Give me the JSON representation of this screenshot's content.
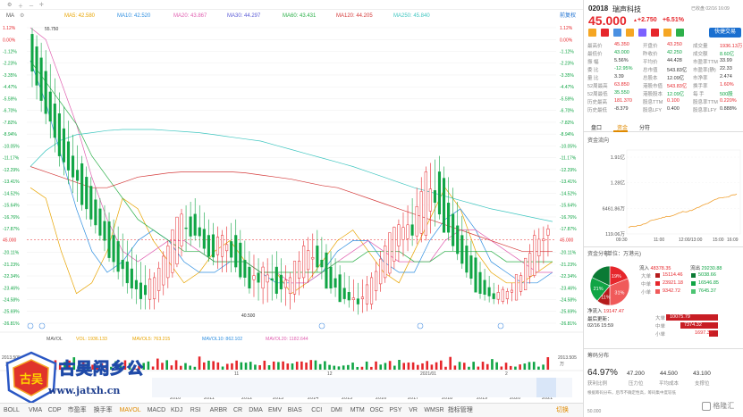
{
  "toolbar_top": {
    "ma_label": "MA",
    "ma_items": [
      {
        "label": "MA5: 42.580",
        "color": "#e8a400"
      },
      {
        "label": "MA10: 42.520",
        "color": "#2f8fe0"
      },
      {
        "label": "MA20: 43.867",
        "color": "#e060b0"
      },
      {
        "label": "MA30: 44.297",
        "color": "#5b5bd6"
      },
      {
        "label": "MA60: 43.431",
        "color": "#2db04a"
      },
      {
        "label": "MA120: 44.205",
        "color": "#d43a3a"
      },
      {
        "label": "MA250: 45.840",
        "color": "#3fc6c0"
      }
    ],
    "right_label": "前复权"
  },
  "price_axis": {
    "left_labels": [
      "1.12%",
      "0.00%",
      "-1.12%",
      "-2.23%",
      "-3.35%",
      "-4.47%",
      "-5.59%",
      "-6.70%",
      "-7.82%",
      "-8.94%",
      "-10.05%",
      "-11.17%",
      "-12.29%",
      "-13.41%",
      "-14.52%",
      "-15.64%",
      "-16.76%",
      "-17.87%",
      "-20.11%",
      "-21.23%",
      "-22.34%",
      "-23.46%",
      "-24.58%",
      "-25.69%",
      "-26.81%"
    ],
    "right_labels": [
      "1.12%",
      "0.00%",
      "-1.12%",
      "-2.23%",
      "-3.35%",
      "-4.47%",
      "-5.59%",
      "-6.70%",
      "-7.82%",
      "-8.94%",
      "-10.05%",
      "-11.17%",
      "-12.29%",
      "-13.41%",
      "-14.52%",
      "-15.64%",
      "-16.76%",
      "-17.87%",
      "-20.11%",
      "-21.23%",
      "-22.34%",
      "-23.46%",
      "-24.58%",
      "-25.69%",
      "-26.81%"
    ],
    "current_price": "45.000",
    "high_marker": "55.750",
    "low_marker": "40.500"
  },
  "volume": {
    "title": "MAVOL",
    "vol": "VOL: 1936.133",
    "mavol5": "MAVOL5: 763.215",
    "mavol10": "MAVOL10: 862.102",
    "mavol20": "MAVOL20: 1182.644",
    "axis_top": "2013.505",
    "axis_top_unit": "万",
    "axis_right_top": "2013.505",
    "axis_right_unit": "万"
  },
  "time_axis": [
    "2010",
    "2011",
    "2012",
    "2013",
    "2014",
    "2015",
    "2016",
    "2017",
    "2018",
    "2019",
    "2020",
    "2021"
  ],
  "time_axis_extra": {
    "mid": "2021/01",
    "a": "11",
    "b": "12",
    "c": "2"
  },
  "bottom_tabs": [
    "VMA",
    "CDP",
    "市盈率",
    "换手率",
    "MAVOL",
    "MACD",
    "KDJ",
    "RSI",
    "ARBR",
    "CR",
    "DMA",
    "EMV",
    "BIAS",
    "CCI",
    "DMI",
    "MTM",
    "OSC",
    "PSY",
    "VR",
    "WMSR",
    "指标管理"
  ],
  "bottom_right": "切换",
  "bottom_left": "BOLL",
  "watermark": {
    "title": "古吴闲乡公",
    "url": "www.jatxh.cn"
  },
  "stock": {
    "code": "02018",
    "name": "瑞声科技",
    "date": "已收盘 02/16 16:09",
    "price": "45.000",
    "change": "+2.750",
    "pct": "+6.51%",
    "trade_button": "快捷交易"
  },
  "quote_table": [
    [
      "最高价",
      "45.350",
      "开盘价",
      "43.250",
      "成交量",
      "1936.13万"
    ],
    [
      "最低价",
      "43.000",
      "昨收价",
      "42.250",
      "成交额",
      "8.60亿"
    ],
    [
      "振    幅",
      "5.56%",
      "平均价",
      "44.428",
      "市盈率TTM",
      "33.99"
    ],
    [
      "委    比",
      "-12.95%",
      "总市值",
      "543.83亿",
      "市盈率(静)",
      "22.33"
    ],
    [
      "量    比",
      "3.39",
      "总股本",
      "12.09亿",
      "市净率",
      "2.474"
    ],
    [
      "52周最高",
      "63.850",
      "港股市值",
      "543.83亿",
      "换手率",
      "1.60%"
    ],
    [
      "52周最低",
      "35.550",
      "港股股本",
      "12.09亿",
      "每    手",
      "500股"
    ],
    [
      "历史最高",
      "181.370",
      "股息TTM",
      "0.100",
      "股息率TTM",
      "0.220%"
    ],
    [
      "历史最低",
      "-8.379",
      "股息LFY",
      "0.400",
      "股息率LFY",
      "0.888%"
    ]
  ],
  "detail_tabs": [
    "盘口",
    "资金",
    "分符"
  ],
  "flow_chart": {
    "title": "资金流向",
    "y_labels": [
      "1.91亿",
      "1.28亿",
      "6461.86万",
      "119.06万"
    ],
    "x_labels": [
      "09:30",
      "11:00",
      "12:00/13:00",
      "15:00",
      "16:09"
    ]
  },
  "distribution": {
    "title": "资金分布",
    "unit": "(单位：万港元)",
    "inflow_label": "流入",
    "inflow_total": "48378.35",
    "outflow_label": "流出",
    "outflow_total": "29230.88",
    "rows": [
      {
        "label": "大单",
        "in": "15114.46",
        "out": "5038.66"
      },
      {
        "label": "中单",
        "in": "23921.18",
        "out": "16546.85"
      },
      {
        "label": "小单",
        "in": "9342.72",
        "out": "7645.37"
      }
    ],
    "pie": [
      {
        "label": "19%",
        "value": 19,
        "color": "#e6262b"
      },
      {
        "label": "31%",
        "value": 31,
        "color": "#f05a5a"
      },
      {
        "label": "11%",
        "value": 11,
        "color": "#b51b1b"
      },
      {
        "label": "21%",
        "value": 21,
        "color": "#10a545"
      },
      {
        "label": "",
        "value": 18,
        "color": "#0a7a34"
      }
    ],
    "net_label": "净流入",
    "net_value": "19147.47",
    "update_label": "最后更新：",
    "update_time": "02/16 15:59",
    "net_rows": [
      {
        "label": "大单",
        "value": "10075.79",
        "fraction": 1.0
      },
      {
        "label": "中单",
        "value": "7374.32",
        "fraction": 0.73
      },
      {
        "label": "小单",
        "value": "1697.35",
        "fraction": 0.17
      }
    ]
  },
  "chip": {
    "title": "筹码分布",
    "profit_pct": "64.97%",
    "profit_label": "获利比例",
    "pressure": "47.200",
    "pressure_label": "压力位",
    "avg": "44.500",
    "avg_label": "平均成本",
    "support": "43.100",
    "support_label": "支撑位",
    "note": "根据筹码分布，后市不确定性高，筹码集中度较低",
    "footer_value": "50.000",
    "brand": "格隆汇"
  },
  "colors": {
    "up": "#e6262b",
    "down": "#10a545",
    "accent": "#e08a00"
  },
  "chart_data": {
    "type": "candlestick",
    "title": "",
    "xlabel": "",
    "ylabel": "",
    "x_range": [
      "2009",
      "2021/02"
    ],
    "ylim_pct": [
      -26.81,
      1.12
    ],
    "grid": true,
    "ma_series": [
      {
        "name": "MA5",
        "color": "#e8a400",
        "pct": [
          -14,
          -15,
          -20,
          -24,
          -23,
          -20,
          -15,
          -16,
          -19,
          -21,
          -23,
          -22,
          -20,
          -19,
          -21,
          -22,
          -22,
          -24,
          -23,
          -21,
          -19,
          -18,
          -20,
          -22,
          -23,
          -20,
          -17,
          -14,
          -16,
          -20,
          -22,
          -23,
          -23,
          -22,
          -21
        ]
      },
      {
        "name": "MA10",
        "color": "#2f8fe0",
        "pct": [
          -2,
          -6,
          -11,
          -16,
          -20,
          -22,
          -21,
          -19,
          -18,
          -19,
          -21,
          -22,
          -22,
          -21,
          -21,
          -22,
          -23,
          -23,
          -23,
          -22,
          -20,
          -19,
          -19,
          -21,
          -22,
          -22,
          -19,
          -17,
          -16,
          -18,
          -21,
          -22,
          -23,
          -23,
          -22
        ]
      },
      {
        "name": "MA20",
        "color": "#e060b0",
        "pct": [
          4,
          0,
          -4,
          -8,
          -13,
          -17,
          -20,
          -21,
          -20,
          -19,
          -19,
          -20,
          -21,
          -21,
          -21,
          -22,
          -22,
          -23,
          -23,
          -22,
          -21,
          -20,
          -19,
          -20,
          -21,
          -21,
          -21,
          -19,
          -18,
          -18,
          -19,
          -20,
          -21,
          -22,
          -22
        ]
      },
      {
        "name": "MA60",
        "color": "#2db04a",
        "pct": [
          -2,
          -4,
          -6,
          -8,
          -11,
          -13,
          -15,
          -17,
          -18,
          -19,
          -20,
          -20,
          -21,
          -21,
          -21,
          -22,
          -22,
          -22,
          -22,
          -22,
          -21,
          -21,
          -20,
          -20,
          -20,
          -21,
          -21,
          -20,
          -20,
          -20,
          -20,
          -21,
          -21,
          -21,
          -21
        ]
      },
      {
        "name": "MA120",
        "color": "#d43a3a",
        "pct": [
          -12,
          -12.5,
          -13,
          -13.5,
          -14,
          -14,
          -13.5,
          -13,
          -12.8,
          -12.6,
          -12.5,
          -12.5,
          -12.5,
          -12.5,
          -12.6,
          -12.8,
          -13,
          -13.2,
          -13.5,
          -13.8,
          -14,
          -14.5,
          -15,
          -15.5,
          -16,
          -16.5,
          -17,
          -17.5,
          -18,
          -18.5,
          -19,
          -19.5,
          -20,
          -20,
          -20
        ]
      },
      {
        "name": "MA250",
        "color": "#3fc6c0",
        "pct": [
          -12,
          -10.5,
          -9.5,
          -9,
          -8.8,
          -8.6,
          -8.5,
          -8.5,
          -8.5,
          -8.6,
          -8.7,
          -8.8,
          -9,
          -9.2,
          -9.4,
          -9.6,
          -10,
          -10.4,
          -10.8,
          -11.2,
          -11.6,
          -12,
          -12.5,
          -13,
          -13.5,
          -14,
          -14.4,
          -14.8,
          -15.2,
          -15.6,
          -16,
          -16.3,
          -16.6,
          -16.9,
          -17.2
        ]
      }
    ],
    "candles_pct": [
      [
        0.5,
        1.1,
        -4.5,
        -3.0
      ],
      [
        -3,
        -1,
        -8,
        -7
      ],
      [
        -7,
        -5,
        -12,
        -11
      ],
      [
        -11,
        -9,
        -14.5,
        -13
      ],
      [
        -13,
        -12,
        -17,
        -16
      ],
      [
        -16,
        -15,
        -19,
        -18.5
      ],
      [
        -18.5,
        -17,
        -22,
        -21
      ],
      [
        -21,
        -19,
        -24,
        -23
      ],
      [
        -23,
        -21,
        -25.5,
        -24.5
      ],
      [
        -24.5,
        -22,
        -25.5,
        -22.5
      ],
      [
        -22.5,
        -19,
        -23.5,
        -19.5
      ],
      [
        -19.5,
        -16,
        -20.5,
        -16.5
      ],
      [
        -16.5,
        -15,
        -19,
        -18.5
      ],
      [
        -18.5,
        -17,
        -21,
        -20.5
      ],
      [
        -20.5,
        -18,
        -22,
        -18.5
      ],
      [
        -18.5,
        -17,
        -22,
        -21.5
      ],
      [
        -21.5,
        -20,
        -24,
        -23.5
      ],
      [
        -23.5,
        -21,
        -25,
        -21.5
      ],
      [
        -21.5,
        -20,
        -24.5,
        -24
      ],
      [
        -24,
        -22,
        -25.5,
        -22.5
      ],
      [
        -22.5,
        -19,
        -23.5,
        -19.5
      ],
      [
        -19.5,
        -18,
        -22,
        -21.5
      ],
      [
        -21.5,
        -20,
        -24,
        -23.5
      ],
      [
        -23.5,
        -22,
        -25,
        -24.5
      ],
      [
        -24.5,
        -23,
        -26,
        -25
      ],
      [
        -25,
        -22,
        -25.5,
        -22.5
      ],
      [
        -22.5,
        -19,
        -23,
        -19.5
      ],
      [
        -19.5,
        -17,
        -21,
        -17.5
      ],
      [
        -17.5,
        -15,
        -19.5,
        -18.5
      ],
      [
        -18.5,
        -12,
        -19,
        -12.5
      ],
      [
        -12.5,
        -11,
        -17,
        -16.5
      ],
      [
        -16.5,
        -14,
        -20,
        -19.5
      ],
      [
        -19.5,
        -18,
        -22.5,
        -22
      ],
      [
        -22,
        -21,
        -24.5,
        -24
      ],
      [
        -24,
        -23,
        -25,
        -24.5
      ],
      [
        -24.5,
        -23.5,
        -25,
        -23.8
      ],
      [
        -23.8,
        -22,
        -24.2,
        -22.3
      ],
      [
        -22.3,
        -18,
        -22.5,
        -18.5
      ],
      [
        -18.5,
        -17.5,
        -20.5,
        -17.9
      ]
    ]
  }
}
